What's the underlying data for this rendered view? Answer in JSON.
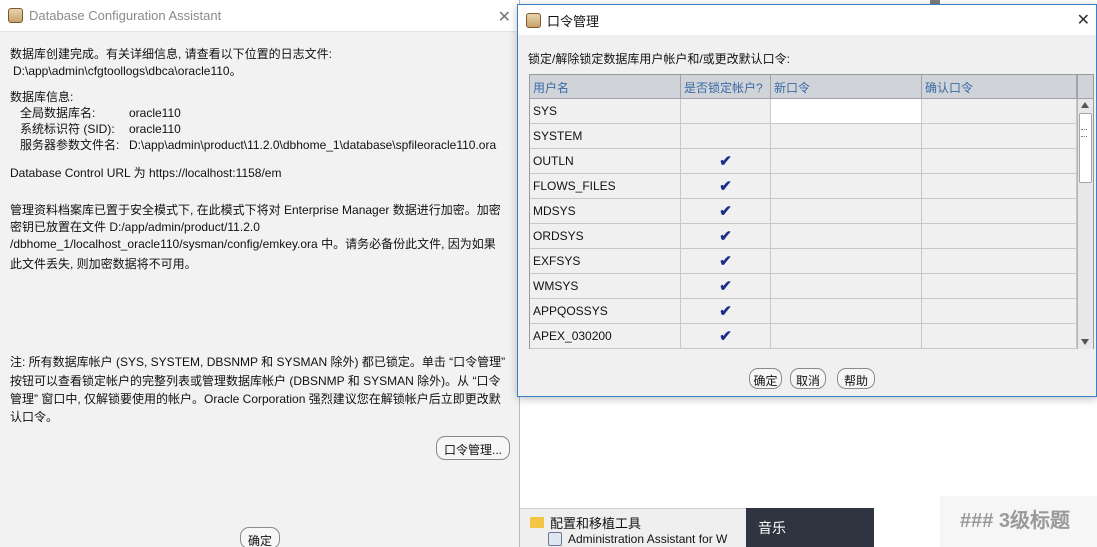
{
  "background": {
    "start_menu": {
      "folder_label": "配置和移植工具",
      "app_label": "Administration Assistant for W"
    },
    "music_tile": "音乐",
    "markdown_heading": "### 3级标题"
  },
  "dbca": {
    "title": "Database Configuration Assistant",
    "creation_done": "数据库创建完成。有关详细信息, 请查看以下位置的日志文件:",
    "log_path": "D:\\app\\admin\\cfgtoollogs\\dbca\\oracle110。",
    "info_heading": "数据库信息:",
    "global_db_name_label": "全局数据库名:",
    "global_db_name_value": "oracle110",
    "sid_label": "系统标识符 (SID):",
    "sid_value": "oracle110",
    "spfile_label": "服务器参数文件名:",
    "spfile_value": "D:\\app\\admin\\product\\11.2.0\\dbhome_1\\database\\spfileoracle110.ora",
    "control_url": "Database Control URL 为 https://localhost:1158/em",
    "secure_lines": [
      "管理资料档案库已置于安全模式下, 在此模式下将对 Enterprise Manager 数据进行加密。加密",
      "密钥已放置在文件 D:/app/admin/product/11.2.0",
      "/dbhome_1/localhost_oracle110/sysman/config/emkey.ora 中。请务必备份此文件, 因为如果",
      "此文件丢失, 则加密数据将不可用。"
    ],
    "note_lines": [
      "注: 所有数据库帐户 (SYS, SYSTEM, DBSNMP 和 SYSMAN 除外) 都已锁定。单击 “口令管理”",
      "按钮可以查看锁定帐户的完整列表或管理数据库帐户 (DBSNMP 和 SYSMAN 除外)。从 “口令",
      "管理” 窗口中, 仅解锁要使用的帐户。Oracle Corporation 强烈建议您在解锁帐户后立即更改默",
      "认口令。"
    ],
    "password_mgmt_button": "口令管理...",
    "ok_button": "确定"
  },
  "pwdialog": {
    "title": "口令管理",
    "prompt": "锁定/解除锁定数据库用户帐户和/或更改默认口令:",
    "columns": [
      "用户名",
      "是否锁定帐户?",
      "新口令",
      "确认口令"
    ],
    "rows": [
      {
        "user": "SYS",
        "locked": "",
        "new_pw": "",
        "confirm_pw": ""
      },
      {
        "user": "SYSTEM",
        "locked": "",
        "new_pw": "",
        "confirm_pw": ""
      },
      {
        "user": "OUTLN",
        "locked": "✔",
        "new_pw": "",
        "confirm_pw": ""
      },
      {
        "user": "FLOWS_FILES",
        "locked": "✔",
        "new_pw": "",
        "confirm_pw": ""
      },
      {
        "user": "MDSYS",
        "locked": "✔",
        "new_pw": "",
        "confirm_pw": ""
      },
      {
        "user": "ORDSYS",
        "locked": "✔",
        "new_pw": "",
        "confirm_pw": ""
      },
      {
        "user": "EXFSYS",
        "locked": "✔",
        "new_pw": "",
        "confirm_pw": ""
      },
      {
        "user": "WMSYS",
        "locked": "✔",
        "new_pw": "",
        "confirm_pw": ""
      },
      {
        "user": "APPQOSSYS",
        "locked": "✔",
        "new_pw": "",
        "confirm_pw": ""
      },
      {
        "user": "APEX_030200",
        "locked": "✔",
        "new_pw": "",
        "confirm_pw": ""
      }
    ],
    "ok_button": "确定",
    "cancel_button": "取消",
    "help_button": "帮助"
  }
}
